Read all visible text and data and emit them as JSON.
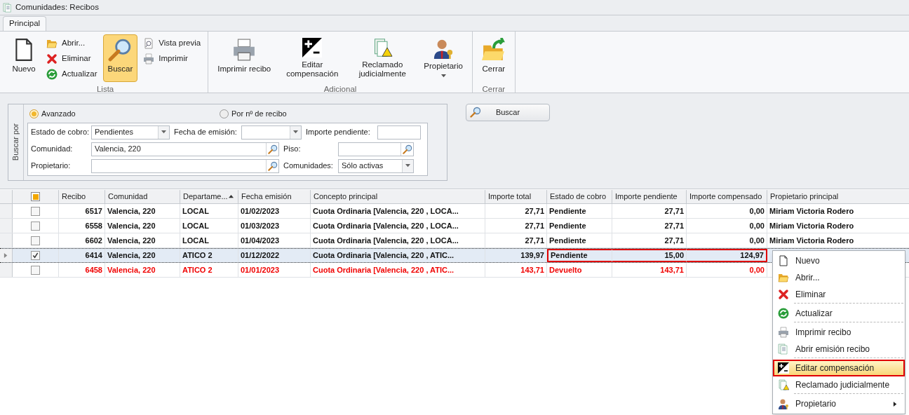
{
  "window": {
    "title": "Comunidades: Recibos"
  },
  "tabs": [
    {
      "label": "Principal",
      "selected": true
    }
  ],
  "ribbon": {
    "groups": [
      {
        "label": "Lista",
        "items": [
          {
            "label": "Nuevo",
            "kind": "large",
            "selected": false
          },
          {
            "label": "Abrir...",
            "kind": "small",
            "selected": false
          },
          {
            "label": "Eliminar",
            "kind": "small",
            "selected": false
          },
          {
            "label": "Actualizar",
            "kind": "small",
            "selected": false
          },
          {
            "label": "Buscar",
            "kind": "large",
            "selected": true
          },
          {
            "label": "Vista previa",
            "kind": "small",
            "selected": false
          },
          {
            "label": "Imprimir",
            "kind": "small",
            "selected": false
          }
        ]
      },
      {
        "label": "Adicional",
        "items": [
          {
            "label": "Imprimir recibo",
            "kind": "large",
            "selected": false
          },
          {
            "label": "Editar compensación",
            "kind": "large",
            "selected": false
          },
          {
            "label": "Reclamado judicialmente",
            "kind": "large",
            "selected": false
          },
          {
            "label": "Propietario",
            "kind": "dropdown",
            "selected": false
          }
        ]
      },
      {
        "label": "Cerrar",
        "items": [
          {
            "label": "Cerrar",
            "kind": "large",
            "selected": false
          }
        ]
      }
    ]
  },
  "search": {
    "group_label": "Buscar por",
    "modes": [
      {
        "label": "Avanzado",
        "selected": true
      },
      {
        "label": "Por nº de recibo",
        "selected": false
      }
    ],
    "fields": [
      [
        {
          "label": "Estado de cobro:",
          "kind": "combo",
          "value": "Pendientes"
        },
        {
          "label": "Fecha de emisión:",
          "kind": "combo"
        },
        {
          "label": "Importe pendiente:",
          "kind": "text"
        }
      ],
      [
        {
          "label": "Comunidad:",
          "kind": "lookup",
          "value": "Valencia, 220"
        },
        {
          "label": "Piso:",
          "kind": "lookup"
        }
      ],
      [
        {
          "label": "Propietario:",
          "kind": "lookup"
        },
        {
          "label": "Comunidades:",
          "kind": "combo",
          "value": "Sólo activas"
        }
      ]
    ],
    "button": "Buscar"
  },
  "grid": {
    "select_all_mixed": true,
    "columns": [
      {
        "label": "Recibo",
        "sort_asc": false
      },
      {
        "label": "Comunidad",
        "sort_asc": false
      },
      {
        "label": "Departame...",
        "sort_asc": true
      },
      {
        "label": "Fecha emisión",
        "sort_asc": false
      },
      {
        "label": "Concepto principal",
        "sort_asc": false
      },
      {
        "label": "Importe total",
        "sort_asc": false
      },
      {
        "label": "Estado de cobro",
        "sort_asc": false
      },
      {
        "label": "Importe pendiente",
        "sort_asc": false
      },
      {
        "label": "Importe compensado",
        "sort_asc": false
      },
      {
        "label": "Propietario principal",
        "sort_asc": false
      }
    ],
    "rows": [
      {
        "checked": false,
        "selected": false,
        "returned": false,
        "cells": [
          "6517",
          "Valencia, 220",
          "LOCAL",
          "01/02/2023",
          "Cuota Ordinaria [Valencia, 220 , LOCA...",
          "27,71",
          "Pendiente",
          "27,71",
          "0,00",
          "Miriam Victoria Rodero"
        ],
        "outlined": [
          false,
          false,
          false,
          false,
          false,
          false,
          false,
          false,
          false,
          false
        ]
      },
      {
        "checked": false,
        "selected": false,
        "returned": false,
        "cells": [
          "6558",
          "Valencia, 220",
          "LOCAL",
          "01/03/2023",
          "Cuota Ordinaria [Valencia, 220 , LOCA...",
          "27,71",
          "Pendiente",
          "27,71",
          "0,00",
          "Miriam Victoria Rodero"
        ],
        "outlined": [
          false,
          false,
          false,
          false,
          false,
          false,
          false,
          false,
          false,
          false
        ]
      },
      {
        "checked": false,
        "selected": false,
        "returned": false,
        "cells": [
          "6602",
          "Valencia, 220",
          "LOCAL",
          "01/04/2023",
          "Cuota Ordinaria [Valencia, 220 , LOCA...",
          "27,71",
          "Pendiente",
          "27,71",
          "0,00",
          "Miriam Victoria Rodero"
        ],
        "outlined": [
          false,
          false,
          false,
          false,
          false,
          false,
          false,
          false,
          false,
          false
        ]
      },
      {
        "checked": true,
        "selected": true,
        "returned": false,
        "cells": [
          "6414",
          "Valencia, 220",
          "ATICO 2",
          "01/12/2022",
          "Cuota Ordinaria [Valencia, 220 , ATIC...",
          "139,97",
          "Pendiente",
          "15,00",
          "124,97"
        ],
        "outlined": [
          false,
          false,
          false,
          false,
          false,
          false,
          true,
          true,
          true,
          false
        ]
      },
      {
        "checked": false,
        "selected": false,
        "returned": true,
        "cells": [
          "6458",
          "Valencia, 220",
          "ATICO 2",
          "01/01/2023",
          "Cuota Ordinaria [Valencia, 220 , ATIC...",
          "143,71",
          "Devuelto",
          "143,71",
          "0,00"
        ],
        "outlined": [
          false,
          false,
          false,
          false,
          false,
          false,
          false,
          false,
          false,
          false
        ]
      }
    ]
  },
  "context_menu": {
    "items": [
      {
        "label": "Nuevo",
        "separator_after": false,
        "highlighted": false,
        "submenu": false
      },
      {
        "label": "Abrir...",
        "separator_after": false,
        "highlighted": false,
        "submenu": false
      },
      {
        "label": "Eliminar",
        "separator_after": true,
        "highlighted": false,
        "submenu": false
      },
      {
        "label": "Actualizar",
        "separator_after": true,
        "highlighted": false,
        "submenu": false
      },
      {
        "label": "Imprimir recibo",
        "separator_after": false,
        "highlighted": false,
        "submenu": false
      },
      {
        "label": "Abrir emisión recibo",
        "separator_after": true,
        "highlighted": false,
        "submenu": false
      },
      {
        "label": "Editar compensación",
        "separator_after": false,
        "highlighted": true,
        "submenu": false
      },
      {
        "label": "Reclamado judicialmente",
        "separator_after": true,
        "highlighted": false,
        "submenu": false
      },
      {
        "label": "Propietario",
        "separator_after": false,
        "highlighted": false,
        "submenu": true
      }
    ]
  }
}
